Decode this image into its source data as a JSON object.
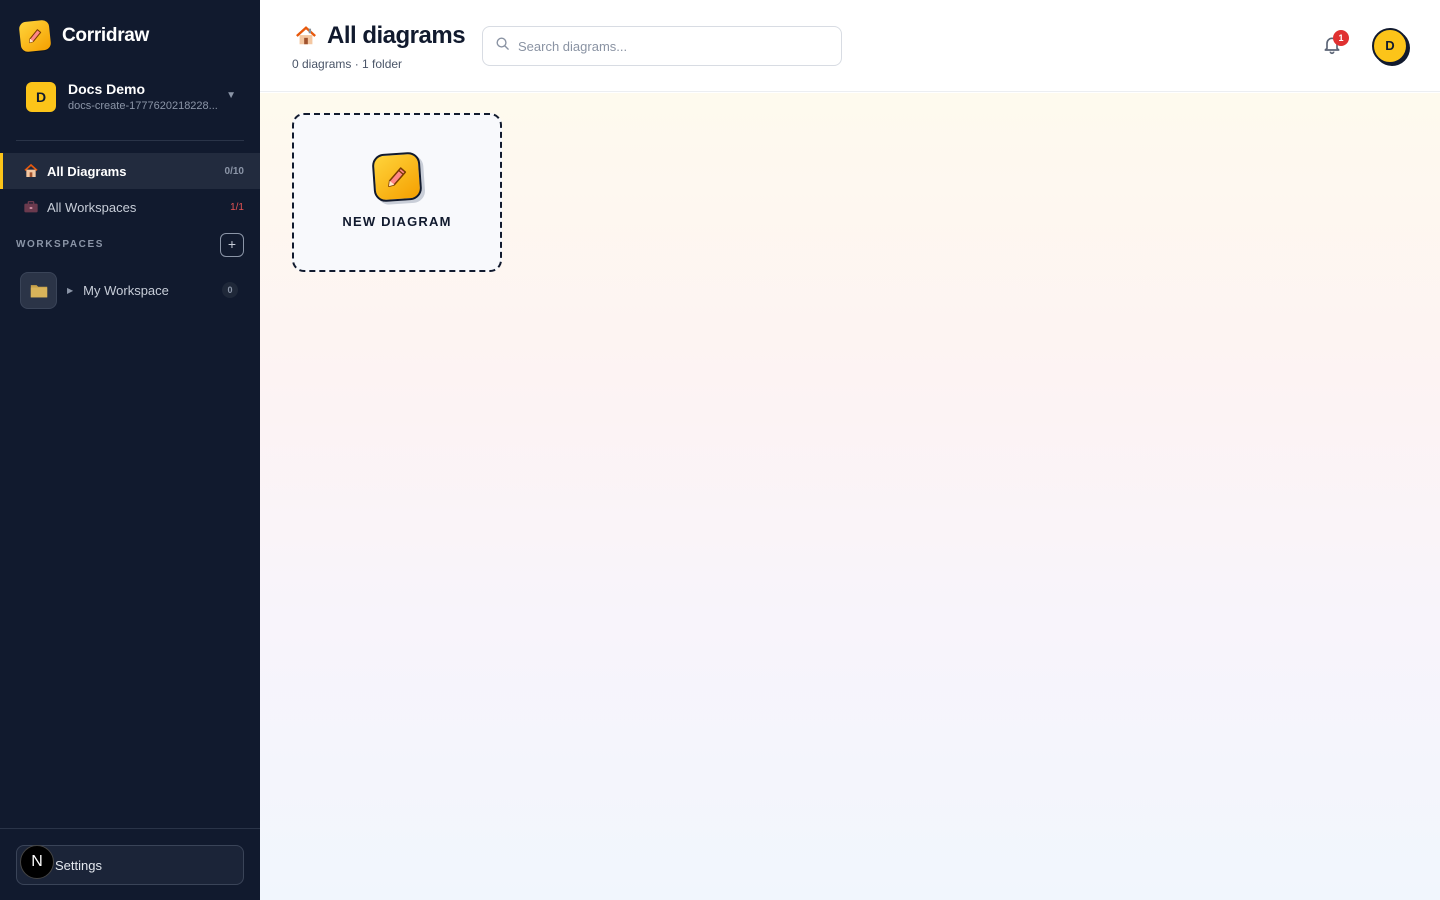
{
  "brand": {
    "name": "Corridraw",
    "icon": "pencil-icon"
  },
  "org": {
    "avatar_letter": "D",
    "name": "Docs Demo",
    "slug": "docs-create-1777620218228..."
  },
  "nav": {
    "all_diagrams": {
      "label": "All Diagrams",
      "count": "0/10",
      "icon": "house-icon"
    },
    "all_workspaces": {
      "label": "All Workspaces",
      "count": "1/1",
      "icon": "briefcase-icon"
    }
  },
  "workspaces": {
    "section_title": "WORKSPACES",
    "add_label": "+",
    "items": [
      {
        "name": "My Workspace",
        "count": "0",
        "icon": "folder-icon"
      }
    ]
  },
  "footer": {
    "settings_label": "Settings",
    "badge_letter": "N"
  },
  "header": {
    "title": "All diagrams",
    "subtitle": "0 diagrams · 1 folder",
    "search_placeholder": "Search diagrams...",
    "notification_count": "1",
    "user_initial": "D"
  },
  "main": {
    "new_diagram_label": "NEW DIAGRAM"
  },
  "colors": {
    "sidebar_bg": "#111a2e",
    "accent": "#fcc419",
    "badge_red": "#e03131"
  }
}
